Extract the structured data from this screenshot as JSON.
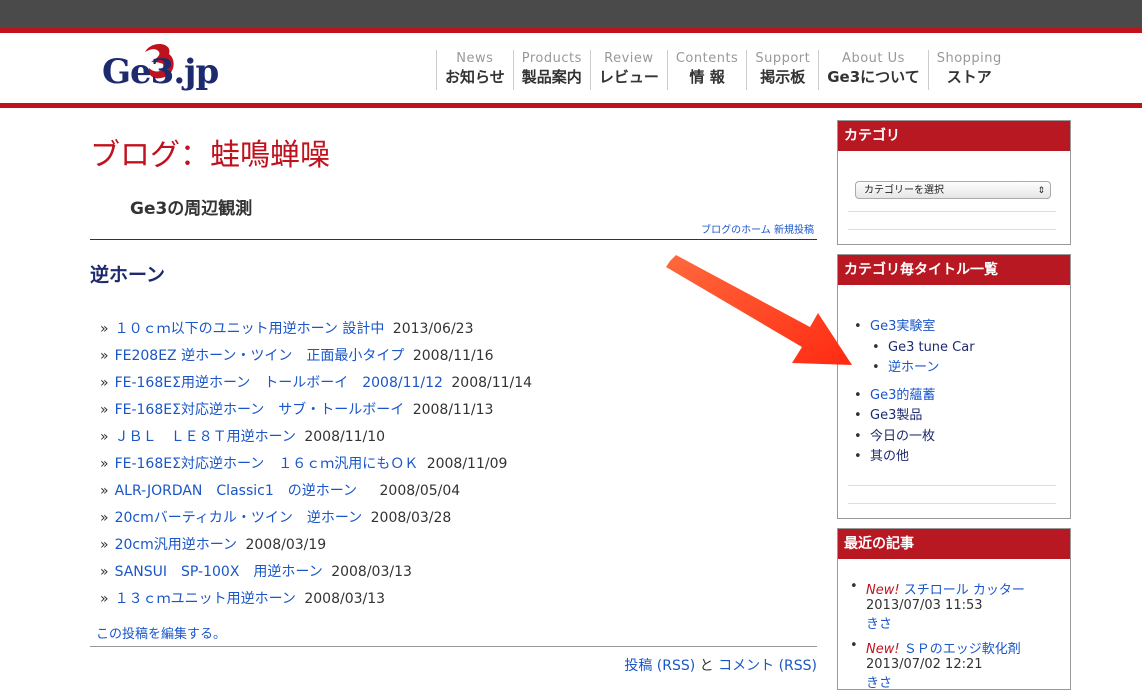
{
  "logo": {
    "text": "Ge3.jp"
  },
  "nav": [
    {
      "en": "News",
      "jp": "お知らせ"
    },
    {
      "en": "Products",
      "jp": "製品案内"
    },
    {
      "en": "Review",
      "jp": "レビュー"
    },
    {
      "en": "Contents",
      "jp": "情 報"
    },
    {
      "en": "Support",
      "jp": "掲示板"
    },
    {
      "en": "About Us",
      "jp": "Ge3について"
    },
    {
      "en": "Shopping",
      "jp": "ストア"
    }
  ],
  "page": {
    "title": "ブログ：蛙鳴蝉噪",
    "subtitle": "Ge3の周辺観測",
    "blog_home": "ブログのホーム",
    "new_post": "新規投稿",
    "post_title": "逆ホーン",
    "edit": "この投稿を編集する。",
    "feeds": {
      "posts": "投稿 (RSS)",
      "and": "と",
      "comments": "コメント (RSS)"
    }
  },
  "posts": [
    {
      "title": "１０ｃｍ以下のユニット用逆ホーン 設計中",
      "date": "2013/06/23"
    },
    {
      "title": "FE208EZ 逆ホーン・ツイン　正面最小タイプ",
      "date": "2008/11/16"
    },
    {
      "title": "FE-168EΣ用逆ホーン　トールボーイ　2008/11/12",
      "date": "2008/11/14"
    },
    {
      "title": "FE-168EΣ対応逆ホーン　サブ・トールボーイ",
      "date": "2008/11/13"
    },
    {
      "title": "ＪＢＬ　ＬＥ８Ｔ用逆ホーン",
      "date": "2008/11/10"
    },
    {
      "title": "FE-168EΣ対応逆ホーン　１６ｃｍ汎用にもＯＫ",
      "date": "2008/11/09"
    },
    {
      "title": "ALR-JORDAN　Classic1　の逆ホーン",
      "date": "　2008/05/04"
    },
    {
      "title": "20cmバーティカル・ツイン　逆ホーン",
      "date": "2008/03/28"
    },
    {
      "title": "20cm汎用逆ホーン",
      "date": "2008/03/19"
    },
    {
      "title": "SANSUI　SP-100X　用逆ホーン",
      "date": "2008/03/13"
    },
    {
      "title": "１３ｃｍユニット用逆ホーン",
      "date": "2008/03/13"
    }
  ],
  "sidebar": {
    "category_head": "カテゴリ",
    "category_select": "カテゴリーを選択",
    "titles_head": "カテゴリ毎タイトル一覧",
    "categories": {
      "lab": "Ge3実験室",
      "tune": "Ge3 tune Car",
      "horn": "逆ホーン",
      "store": "Ge3的蘊蓄",
      "product": "Ge3製品",
      "today": "今日の一枚",
      "other": "其の他"
    },
    "recent_head": "最近の記事",
    "recent": [
      {
        "new": "New!",
        "title": "スチロール カッター",
        "date": "2013/07/03 11:53",
        "author": "きさ"
      },
      {
        "new": "New!",
        "title": "ＳＰのエッジ軟化剤",
        "date": "2013/07/02 12:21",
        "author": "きさ"
      }
    ]
  },
  "colors": {
    "brand_red": "#c0121d",
    "link": "#1a56c9",
    "annotation_arrow": "#ff3b1f"
  }
}
